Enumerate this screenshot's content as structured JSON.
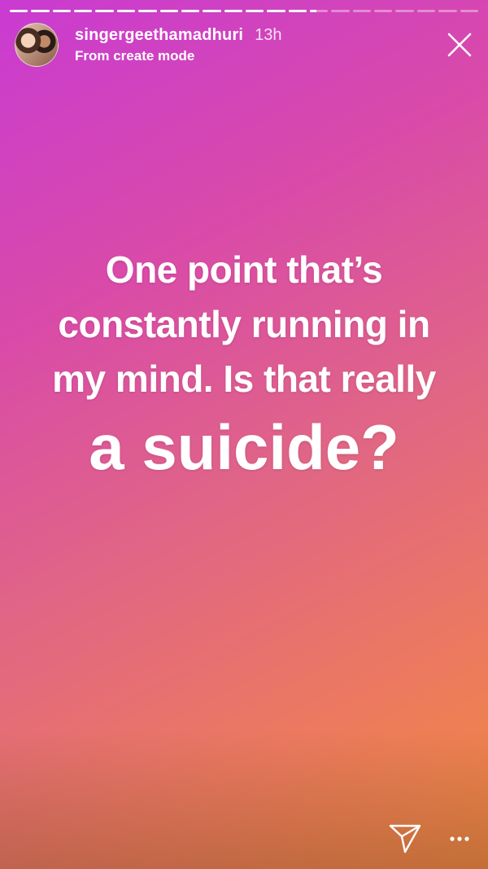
{
  "story": {
    "segments_total": 22,
    "segments_completed": 14,
    "current_segment_progress": 0.35,
    "username": "singergeethamadhuri",
    "time_ago": "13h",
    "subtitle": "From create mode",
    "text_lines": [
      "One point that’s",
      "constantly running in",
      "my mind. Is that really",
      "a suicide?"
    ],
    "colors": {
      "gradient_start": "#c93bd2",
      "gradient_mid": "#e06586",
      "gradient_end": "#f08a3e",
      "text": "#ffffff"
    },
    "icons": {
      "close": "close-icon",
      "send": "send-icon",
      "more": "more-icon"
    }
  }
}
